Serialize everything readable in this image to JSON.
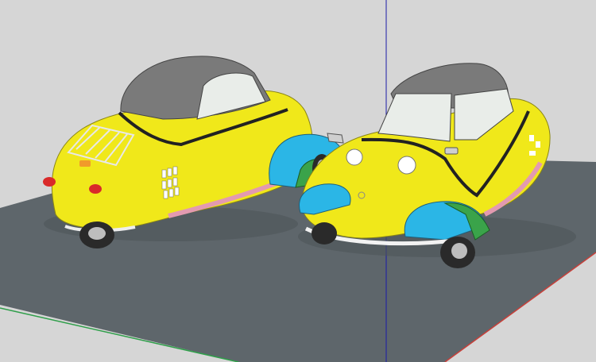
{
  "viewport": {
    "background": "#d6d6d6",
    "ground_color": "#5e666b",
    "axis_blue": "#1a1aa8",
    "axis_green": "#2f9e4a",
    "axis_red": "#c8403a"
  },
  "cars": [
    {
      "name": "bubble-car-rear-view",
      "body_color": "#f0e81a",
      "roof_color": "#7a7a7a",
      "fender_colors": [
        "#2bb6e6",
        "#3aa34a"
      ],
      "trim_color": "#e39ab0",
      "view": "rear"
    },
    {
      "name": "bubble-car-front-view",
      "body_color": "#f0e81a",
      "roof_color": "#7a7a7a",
      "fender_colors": [
        "#2bb6e6",
        "#3aa34a"
      ],
      "trim_color": "#e39ab0",
      "view": "front"
    }
  ]
}
